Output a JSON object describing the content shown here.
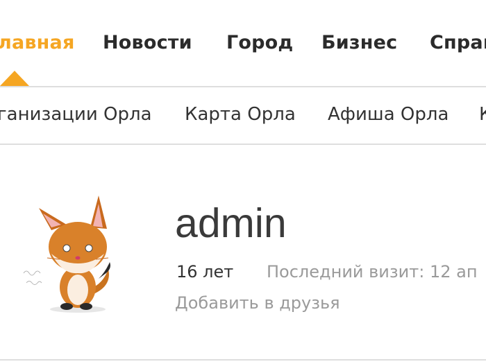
{
  "nav": {
    "items": [
      {
        "label": "лавная",
        "active": true
      },
      {
        "label": "Новости",
        "active": false
      },
      {
        "label": "Город",
        "active": false
      },
      {
        "label": "Бизнес",
        "active": false
      },
      {
        "label": "Справ",
        "active": false
      }
    ],
    "accent_color": "#f5a623"
  },
  "subnav": {
    "items": [
      {
        "label": "ганизации Орла"
      },
      {
        "label": "Карта Орла"
      },
      {
        "label": "Афиша Орла"
      },
      {
        "label": "К"
      }
    ]
  },
  "profile": {
    "username": "admin",
    "age": "16 лет",
    "last_visit": "Последний визит: 12 ап",
    "add_friend": "Добавить в друзья",
    "avatar_icon": "fox-avatar"
  }
}
